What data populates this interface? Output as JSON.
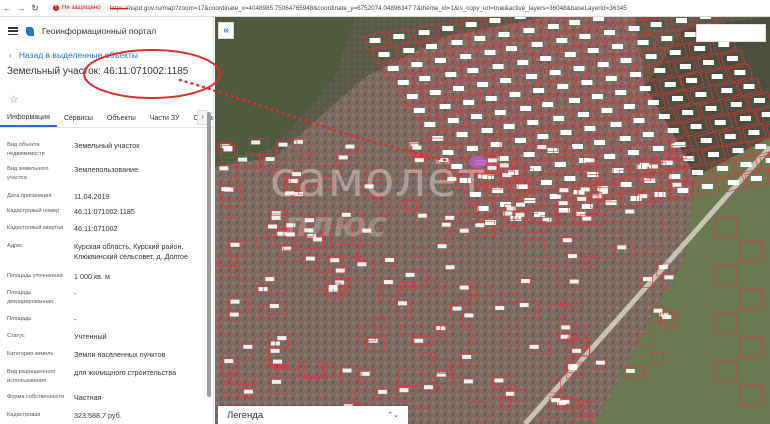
{
  "browser": {
    "insecure_label": "Не защищено",
    "url_scheme": "https://",
    "url_rest": "nspd.gov.ru/map?zoom=17&coordinate_x=4048985.75064765948&coordinate_y=6752074.04896347 7&theme_id=1&is_copy_url=true&active_layers=36048&baseLayerId=36345"
  },
  "app": {
    "title": "Геоинформационный портал"
  },
  "back_link": "Назад в выделенные объекты",
  "object_title": "Земельный участок: 46:11:071002:1185",
  "tabs": [
    "Информация",
    "Сервисы",
    "Объекты",
    "Части ЗУ",
    "Состав"
  ],
  "props": [
    {
      "label": "Вид объекта недвижимости",
      "value": "Земельный участок"
    },
    {
      "label": "Вид земельного участка",
      "value": "Землепользование"
    },
    {
      "label": "Дата присвоения",
      "value": "11.04.2019"
    },
    {
      "label": "Кадастровый номер",
      "value": "46:11:071002:1185"
    },
    {
      "label": "Кадастровый квартал",
      "value": "46:11:071002"
    },
    {
      "label": "Адрес",
      "value": "Курская область, Курский район, Клюквинский сельсовет, д. Долгое"
    },
    {
      "label": "Площадь уточненная",
      "value": "1 000 кв. м"
    },
    {
      "label": "Площадь декларированная",
      "value": "-"
    },
    {
      "label": "Площадь",
      "value": "-"
    },
    {
      "label": "Статус",
      "value": "Учтенный"
    },
    {
      "label": "Категория земель",
      "value": "Земли населенных пунктов"
    },
    {
      "label": "Вид разрешенного использования",
      "value": "для жилищного строительства"
    },
    {
      "label": "Форма собственности",
      "value": "Частная"
    },
    {
      "label": "Кадастровая",
      "value": "323.588,7 руб."
    }
  ],
  "map": {
    "legend_label": "Легенда",
    "watermark": "самолёт",
    "watermark2": "плюс"
  },
  "colors": {
    "accent": "#2d6fd1",
    "parcel_line": "#e0343a",
    "annotation": "#d9302c"
  }
}
